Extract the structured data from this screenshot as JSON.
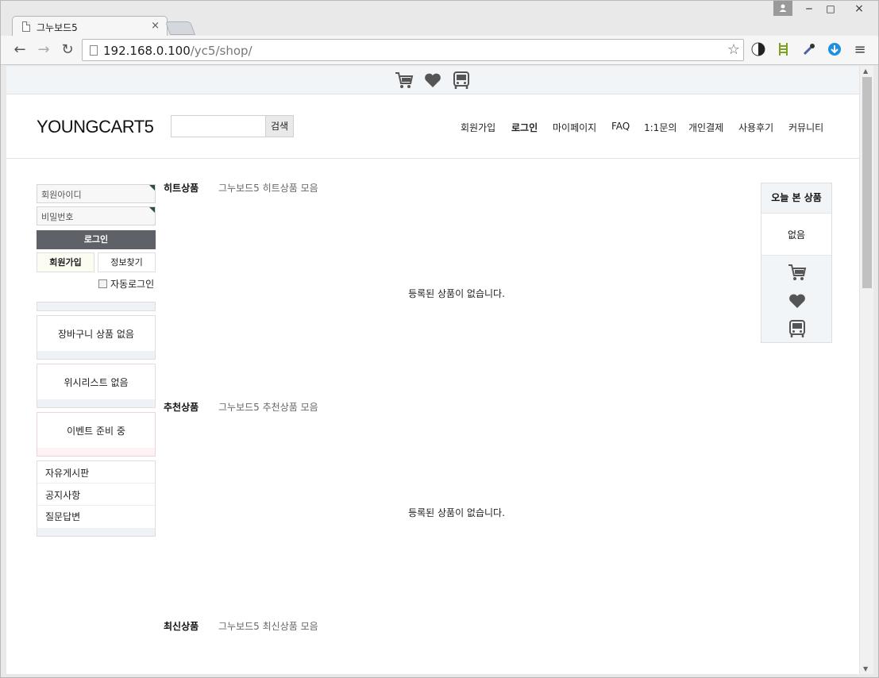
{
  "browser": {
    "tab_title": "그누보드5",
    "tab_close": "×",
    "url_host": "192.168.0.100",
    "url_path": "/yc5/shop/",
    "back": "←",
    "forward": "→",
    "reload": "↻",
    "star": "☆",
    "minimize": "‒",
    "maximize": "□",
    "close": "×",
    "menu": "≡"
  },
  "top_icons": [
    "cart-icon",
    "heart-icon",
    "bus-icon"
  ],
  "header": {
    "logo": "YOUNGCART5",
    "search_button": "검색",
    "nav": [
      "회원가입",
      "로그인",
      "마이페이지",
      "FAQ",
      "1:1문의",
      "개인결제",
      "사용후기",
      "커뮤니티"
    ]
  },
  "login": {
    "id_placeholder": "회원아이디",
    "pw_placeholder": "비밀번호",
    "login_button": "로그인",
    "join_button": "회원가입",
    "find_button": "정보찾기",
    "auto_login": "자동로그인"
  },
  "side_boxes": {
    "cart_empty": "장바구니 상품 없음",
    "wish_empty": "위시리스트 없음",
    "event_empty": "이벤트 준비 중",
    "boards": [
      "자유게시판",
      "공지사항",
      "질문답변"
    ]
  },
  "sections": [
    {
      "title": "히트상품",
      "desc": "그누보드5 히트상품 모음",
      "empty": "등록된 상품이 없습니다."
    },
    {
      "title": "추천상품",
      "desc": "그누보드5 추천상품 모음",
      "empty": "등록된 상품이 없습니다."
    },
    {
      "title": "최신상품",
      "desc": "그누보드5 최신상품 모음",
      "empty": ""
    }
  ],
  "quick": {
    "title": "오늘 본 상품",
    "empty": "없음"
  }
}
